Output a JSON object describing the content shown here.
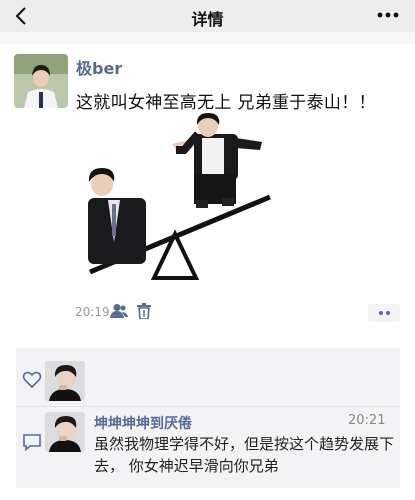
{
  "header": {
    "title": "详情",
    "back_icon": "back-chevron-icon",
    "more_icon": "more-dots-icon"
  },
  "post": {
    "username": "极ber",
    "text": "这就叫女神至高无上 兄弟重于泰山！！",
    "time": "20:19",
    "visibility_icon": "friend-icon",
    "delete_icon": "trash-icon",
    "action_icon": "two-dots-icon"
  },
  "likes": {
    "icon": "heart-outline-icon"
  },
  "comments": [
    {
      "name": "坤坤坤坤到厌倦",
      "time": "20:21",
      "text": "虽然我物理学得不好，但是按这个趋势发展下去， 你女神迟早滑向你兄弟"
    }
  ],
  "colors": {
    "link": "#576b95",
    "topbar": "#ededed",
    "panel": "#f3f3f5"
  }
}
